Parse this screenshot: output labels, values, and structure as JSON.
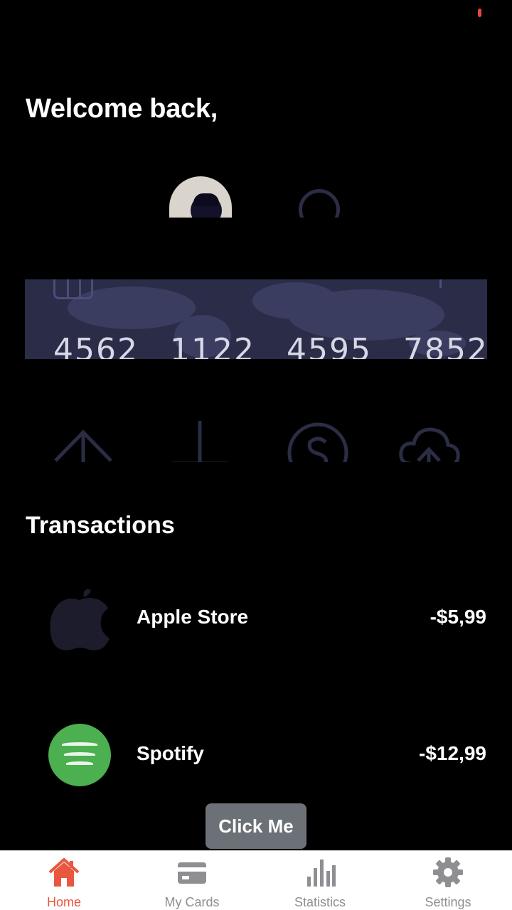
{
  "header": {
    "greeting": "Welcome back,"
  },
  "card": {
    "number_groups": [
      "4562",
      "1122",
      "4595",
      "7852"
    ]
  },
  "transactions": {
    "title": "Transactions",
    "items": [
      {
        "name": "Apple Store",
        "amount": "-$5,99",
        "icon": "apple-logo-icon"
      },
      {
        "name": "Spotify",
        "amount": "-$12,99",
        "icon": "spotify-logo-icon"
      }
    ]
  },
  "floating_button": {
    "label": "Click Me"
  },
  "tabbar": {
    "items": [
      {
        "label": "Home",
        "icon": "home-icon",
        "active": true
      },
      {
        "label": "My Cards",
        "icon": "card-icon",
        "active": false
      },
      {
        "label": "Statistics",
        "icon": "bar-chart-icon",
        "active": false
      },
      {
        "label": "Settings",
        "icon": "gear-icon",
        "active": false
      }
    ]
  },
  "colors": {
    "background": "#000000",
    "accent": "#e9573f",
    "card": "#2a2c48",
    "tab_inactive": "#8e8e93",
    "spotify_green": "#4caf50"
  }
}
